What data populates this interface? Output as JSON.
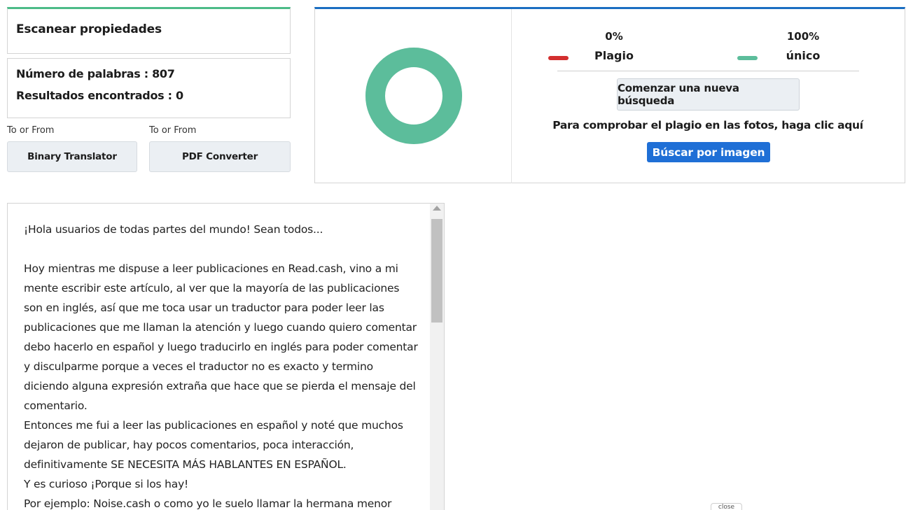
{
  "properties": {
    "title": "Escanear propiedades",
    "word_count": "Número de palabras : 807",
    "results_found": "Resultados encontrados : 0"
  },
  "tools": [
    {
      "label": "To or From",
      "button": "Binary Translator"
    },
    {
      "label": "To or From",
      "button": "PDF Converter"
    }
  ],
  "result": {
    "plagiarism_percent": "0%",
    "plagiarism_label": "Plagio",
    "unique_percent": "100%",
    "unique_label": "único",
    "plagiarism_fraction": 0,
    "unique_fraction": 1,
    "colors": {
      "plagiarism": "#d32f2f",
      "unique": "#5cbd9b",
      "accent_green": "#4cbb87",
      "accent_blue": "#1b6ec2"
    },
    "new_search_button": "Comenzar una nueva búsqueda",
    "photo_hint": "Para comprobar el plagio en las fotos, haga clic aquí",
    "image_search_button": "Búscar por imagen"
  },
  "text": {
    "paragraphs": [
      "¡Hola usuarios de todas partes del mundo! Sean todos...",
      "",
      "Hoy mientras me dispuse a leer publicaciones en Read.cash, vino a mi mente escribir este artículo, al ver que la mayoría de las publicaciones son en inglés, así que me toca usar un traductor para poder leer las publicaciones que me llaman la atención y luego cuando quiero comentar debo hacerlo en español y luego traducirlo en inglés para poder comentar y disculparme porque a veces el traductor no es exacto y termino diciendo alguna expresión extraña que hace que se pierda el mensaje del comentario.",
      "Entonces me fui a leer las publicaciones en español y noté que muchos dejaron de publicar, hay pocos comentarios, poca interacción, definitivamente SE NECESITA MÁS HABLANTES EN ESPAÑOL.",
      "Y es curioso ¡Porque si los hay!",
      "Por ejemplo: Noise.cash o como yo le suelo llamar la hermana menor"
    ]
  },
  "close_chip": "close"
}
